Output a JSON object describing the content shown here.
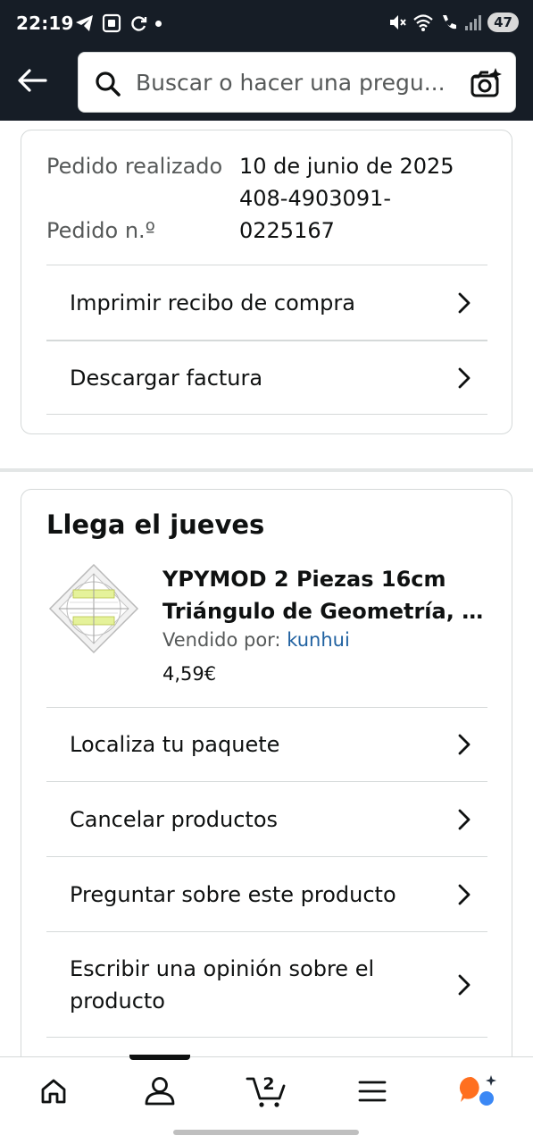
{
  "status_bar": {
    "time": "22:19",
    "battery": "47",
    "left_icons": [
      "telegram-icon",
      "screenshot-icon",
      "sync-icon",
      "dot-icon"
    ],
    "right_icons": [
      "mute-icon",
      "wifi-icon",
      "call-icon",
      "signal-icon"
    ]
  },
  "header": {
    "search_placeholder": "Buscar o hacer una pregu..."
  },
  "order": {
    "placed_label": "Pedido realizado",
    "placed_value": "10 de junio de 2025",
    "number_label": "Pedido n.º",
    "number_value_1": "408-4903091-",
    "number_value_2": "0225167",
    "actions": [
      {
        "label": "Imprimir recibo de compra"
      },
      {
        "label": "Descargar factura"
      }
    ]
  },
  "shipment": {
    "title": "Llega el jueves",
    "product": {
      "title_line1": "YPYMOD 2 Piezas 16cm",
      "title_line2": "Triángulo de Geometría, T...",
      "seller_prefix": "Vendido por: ",
      "seller_name": "kunhui",
      "price": "4,59€"
    },
    "actions": [
      {
        "label": "Localiza tu paquete"
      },
      {
        "label": "Cancelar productos"
      },
      {
        "label": "Preguntar sobre este producto"
      },
      {
        "label": "Escribir una opinión sobre el producto"
      }
    ]
  },
  "bottom_nav": {
    "items": [
      "home-icon",
      "account-icon",
      "cart-icon",
      "menu-icon",
      "rufus-icon"
    ],
    "cart_count": "2",
    "active": "account-icon"
  },
  "colors": {
    "header_bg": "#161d26",
    "link": "#2162a1",
    "rufus_orange": "#ff6f1f",
    "rufus_blue": "#3b88f5"
  }
}
